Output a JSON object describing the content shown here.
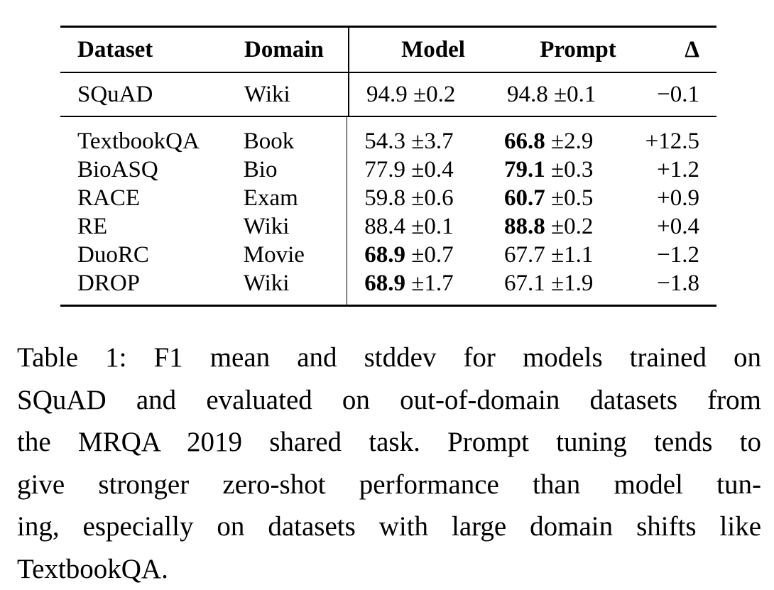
{
  "table": {
    "headers": {
      "dataset": "Dataset",
      "domain": "Domain",
      "model": "Model",
      "prompt": "Prompt",
      "delta": "Δ"
    },
    "in_domain_row": {
      "dataset": "SQuAD",
      "domain": "Wiki",
      "model_mean": "94.9",
      "model_std": "±0.2",
      "model_bold": false,
      "prompt_mean": "94.8",
      "prompt_std": "±0.1",
      "prompt_bold": false,
      "delta": "−0.1"
    },
    "rows": [
      {
        "dataset": "TextbookQA",
        "domain": "Book",
        "model_mean": "54.3",
        "model_std": "±3.7",
        "model_bold": false,
        "prompt_mean": "66.8",
        "prompt_std": "±2.9",
        "prompt_bold": true,
        "delta": "+12.5"
      },
      {
        "dataset": "BioASQ",
        "domain": "Bio",
        "model_mean": "77.9",
        "model_std": "±0.4",
        "model_bold": false,
        "prompt_mean": "79.1",
        "prompt_std": "±0.3",
        "prompt_bold": true,
        "delta": "+1.2"
      },
      {
        "dataset": "RACE",
        "domain": "Exam",
        "model_mean": "59.8",
        "model_std": "±0.6",
        "model_bold": false,
        "prompt_mean": "60.7",
        "prompt_std": "±0.5",
        "prompt_bold": true,
        "delta": "+0.9"
      },
      {
        "dataset": "RE",
        "domain": "Wiki",
        "model_mean": "88.4",
        "model_std": "±0.1",
        "model_bold": false,
        "prompt_mean": "88.8",
        "prompt_std": "±0.2",
        "prompt_bold": true,
        "delta": "+0.4"
      },
      {
        "dataset": "DuoRC",
        "domain": "Movie",
        "model_mean": "68.9",
        "model_std": "±0.7",
        "model_bold": true,
        "prompt_mean": "67.7",
        "prompt_std": "±1.1",
        "prompt_bold": false,
        "delta": "−1.2"
      },
      {
        "dataset": "DROP",
        "domain": "Wiki",
        "model_mean": "68.9",
        "model_std": "±1.7",
        "model_bold": true,
        "prompt_mean": "67.1",
        "prompt_std": "±1.9",
        "prompt_bold": false,
        "delta": "−1.8"
      }
    ]
  },
  "caption": {
    "lines": [
      "Table 1: F1 mean and stddev for models trained on",
      "SQuAD and evaluated on out-of-domain datasets from",
      "the MRQA 2019 shared task. Prompt tuning tends to",
      "give stronger zero-shot performance than model tun-",
      "ing, especially on datasets with large domain shifts like",
      "TextbookQA."
    ]
  }
}
